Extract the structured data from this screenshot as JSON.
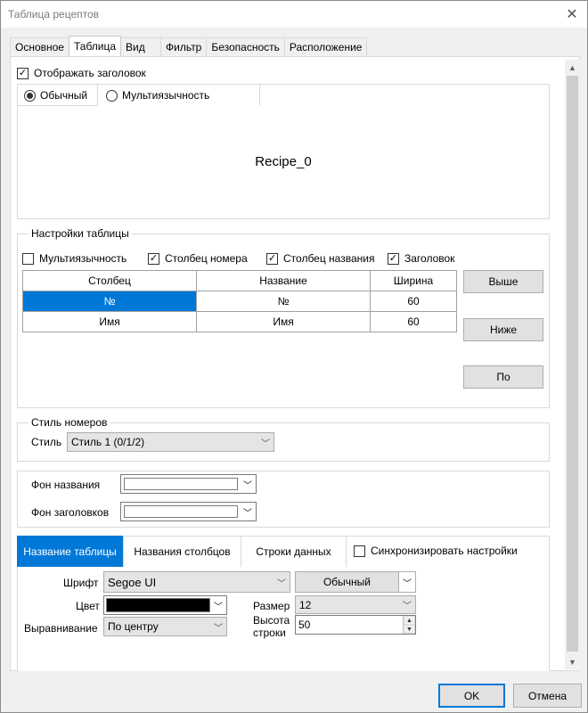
{
  "window": {
    "title": "Таблица рецептов"
  },
  "tabs": [
    "Основное",
    "Таблица",
    "Вид",
    "Фильтр",
    "Безопасность",
    "Расположение"
  ],
  "header": {
    "show_header_label": "Отображать заголовок",
    "show_header_checked": true,
    "mode_normal": "Обычный",
    "mode_multilang": "Мультиязычность",
    "selected_mode": "Обычный",
    "preview_text": "Recipe_0"
  },
  "table_settings": {
    "group_title": "Настройки таблицы",
    "options": [
      {
        "label": "Мультиязычность",
        "checked": false
      },
      {
        "label": "Столбец номера",
        "checked": true
      },
      {
        "label": "Столбец названия",
        "checked": true
      },
      {
        "label": "Заголовок",
        "checked": true
      }
    ],
    "columns": [
      "Столбец",
      "Название",
      "Ширина"
    ],
    "rows": [
      {
        "column": "№",
        "name": "№",
        "width": "60",
        "selected": true
      },
      {
        "column": "Имя",
        "name": "Имя",
        "width": "60",
        "selected": false
      }
    ],
    "up_button": "Выше",
    "down_button": "Ниже",
    "by_button": "По"
  },
  "number_style": {
    "group_title": "Стиль номеров",
    "style_label": "Стиль",
    "style_value": "Стиль 1 (0/1/2)"
  },
  "backgrounds": {
    "title_bg_label": "Фон названия",
    "headers_bg_label": "Фон заголовков"
  },
  "font_section": {
    "subtabs": [
      "Название таблицы",
      "Названия столбцов",
      "Строки данных"
    ],
    "sync_label": "Синхронизировать настройки",
    "sync_checked": false,
    "font_label": "Шрифт",
    "font_value": "Segoe UI",
    "font_style": "Обычный",
    "color_label": "Цвет",
    "color_value": "#000000",
    "size_label": "Размер",
    "size_value": "12",
    "align_label": "Выравнивание",
    "align_value": "По центру",
    "row_height_label_1": "Высота",
    "row_height_label_2": "строки",
    "row_height_value": "50"
  },
  "footer": {
    "ok": "OK",
    "cancel": "Отмена"
  },
  "colors": {
    "accent": "#0078d7"
  }
}
